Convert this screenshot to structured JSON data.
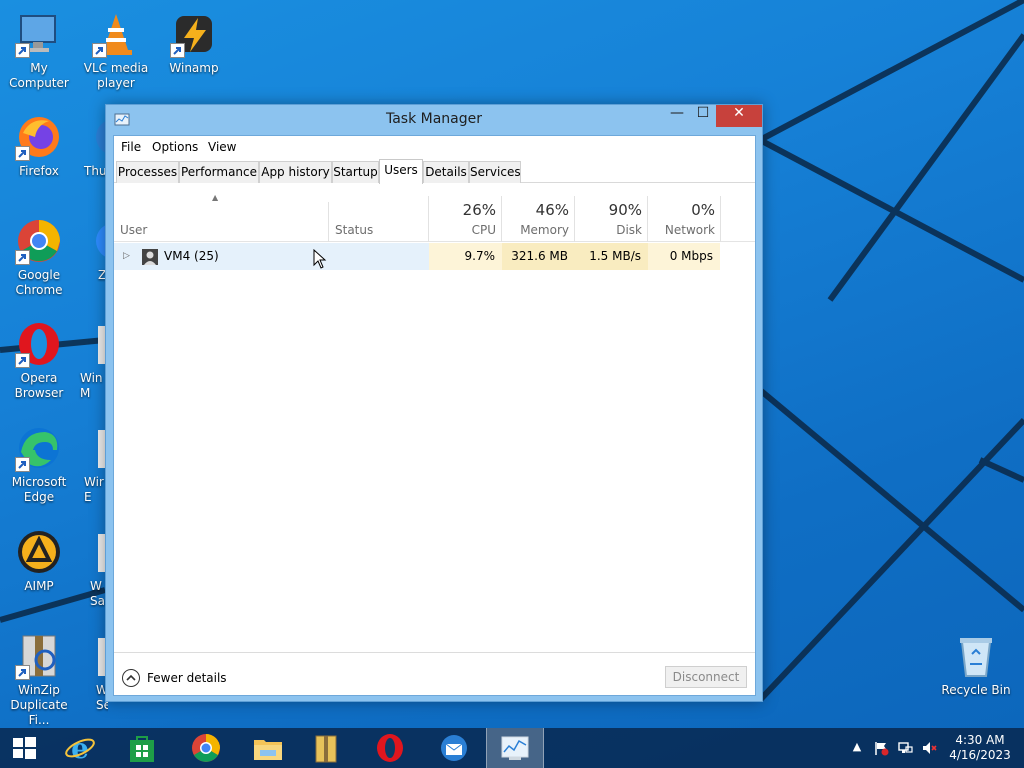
{
  "desktop": {
    "icons": [
      {
        "label": "My Computer"
      },
      {
        "label": "VLC media player"
      },
      {
        "label": "Winamp"
      },
      {
        "label": "Firefox"
      },
      {
        "label": "Thu"
      },
      {
        "label": "Google Chrome"
      },
      {
        "label": "Z"
      },
      {
        "label": "Opera Browser"
      },
      {
        "label": "Win M"
      },
      {
        "label": "Microsoft Edge"
      },
      {
        "label": "Wir E"
      },
      {
        "label": "AIMP"
      },
      {
        "label": "W Sa"
      },
      {
        "label": "WinZip Duplicate Fi..."
      },
      {
        "label": "W Secur..."
      },
      {
        "label": "Recycle Bin"
      }
    ]
  },
  "window": {
    "title": "Task Manager",
    "buttons": {
      "minimize": "—",
      "maximize": "☐",
      "close": "✕"
    }
  },
  "menu": [
    "File",
    "Options",
    "View"
  ],
  "tabs": [
    "Processes",
    "Performance",
    "App history",
    "Startup",
    "Users",
    "Details",
    "Services"
  ],
  "active_tab": "Users",
  "columns": {
    "user": "User",
    "status": "Status",
    "cpu": {
      "pct": "26%",
      "label": "CPU"
    },
    "memory": {
      "pct": "46%",
      "label": "Memory"
    },
    "disk": {
      "pct": "90%",
      "label": "Disk"
    },
    "network": {
      "pct": "0%",
      "label": "Network"
    }
  },
  "rows": [
    {
      "user": "VM4 (25)",
      "status": "",
      "cpu": "9.7%",
      "memory": "321.6 MB",
      "disk": "1.5 MB/s",
      "network": "0 Mbps"
    }
  ],
  "footer": {
    "fewer_details": "Fewer details",
    "disconnect": "Disconnect"
  },
  "taskbar": {
    "apps": [
      "start",
      "internet-explorer",
      "store",
      "chrome",
      "file-explorer",
      "winzip",
      "opera",
      "thunderbird",
      "task-manager"
    ],
    "active_app": "task-manager",
    "time": "4:30 AM",
    "date": "4/16/2023"
  },
  "colors": {
    "accent": "#1a8fe0",
    "row_highlight": "#e5f1fb",
    "heat_light": "#fdf4d8",
    "heat_mid": "#f9ecc0",
    "close_red": "#c7413c"
  }
}
